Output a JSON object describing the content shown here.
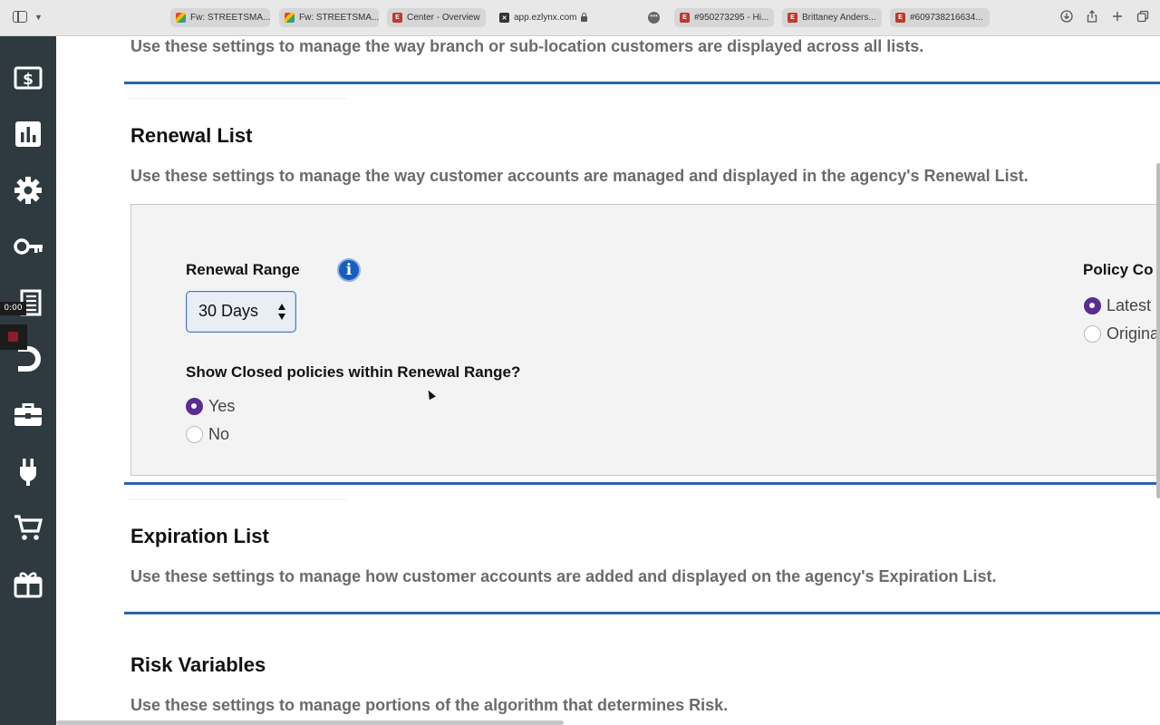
{
  "browser": {
    "tabs": [
      {
        "label": "Fw: STREETSMA...",
        "favicon": "gmail-icon"
      },
      {
        "label": "Fw: STREETSMA...",
        "favicon": "gmail-icon"
      },
      {
        "label": "Center - Overview",
        "favicon": "ezlynx-icon"
      },
      {
        "label": "app.ezlynx.com",
        "favicon": "x-icon",
        "active": true
      },
      {
        "label": "#950273295 - Hi...",
        "favicon": "ezlynx-icon"
      },
      {
        "label": "Brittaney Anders...",
        "favicon": "ezlynx-icon"
      },
      {
        "label": "#609738216634...",
        "favicon": "ezlynx-icon"
      }
    ]
  },
  "rail": {
    "items": [
      "dollar-icon",
      "bar-chart-icon",
      "gear-icon",
      "key-icon",
      "book-icon",
      "magnet-icon",
      "briefcase-icon",
      "plug-icon",
      "cart-icon",
      "gift-icon"
    ],
    "timer": "0:00"
  },
  "sections": {
    "top_desc": "Use these settings to manage the way branch or sub-location customers are displayed across all lists.",
    "renewal": {
      "title": "Renewal List",
      "desc": "Use these settings to manage the way customer accounts are managed and displayed in the agency's Renewal List.",
      "range_label": "Renewal Range",
      "range_value": "30 Days",
      "closed_label": "Show Closed policies within Renewal Range?",
      "closed_options": [
        "Yes",
        "No"
      ],
      "closed_selected": "Yes",
      "policy_label": "Policy Co",
      "policy_options": [
        "Latest",
        "Origina"
      ],
      "policy_selected": "Latest"
    },
    "expiration": {
      "title": "Expiration List",
      "desc": "Use these settings to manage how customer accounts are added and displayed on the agency's Expiration List."
    },
    "risk": {
      "title": "Risk Variables",
      "desc": "Use these settings to manage portions of the algorithm that determines Risk."
    }
  },
  "colors": {
    "rail": "#2e3a40",
    "rule": "#2f63a8",
    "radio_selected": "#5a2d91",
    "info": "#1560bd"
  }
}
